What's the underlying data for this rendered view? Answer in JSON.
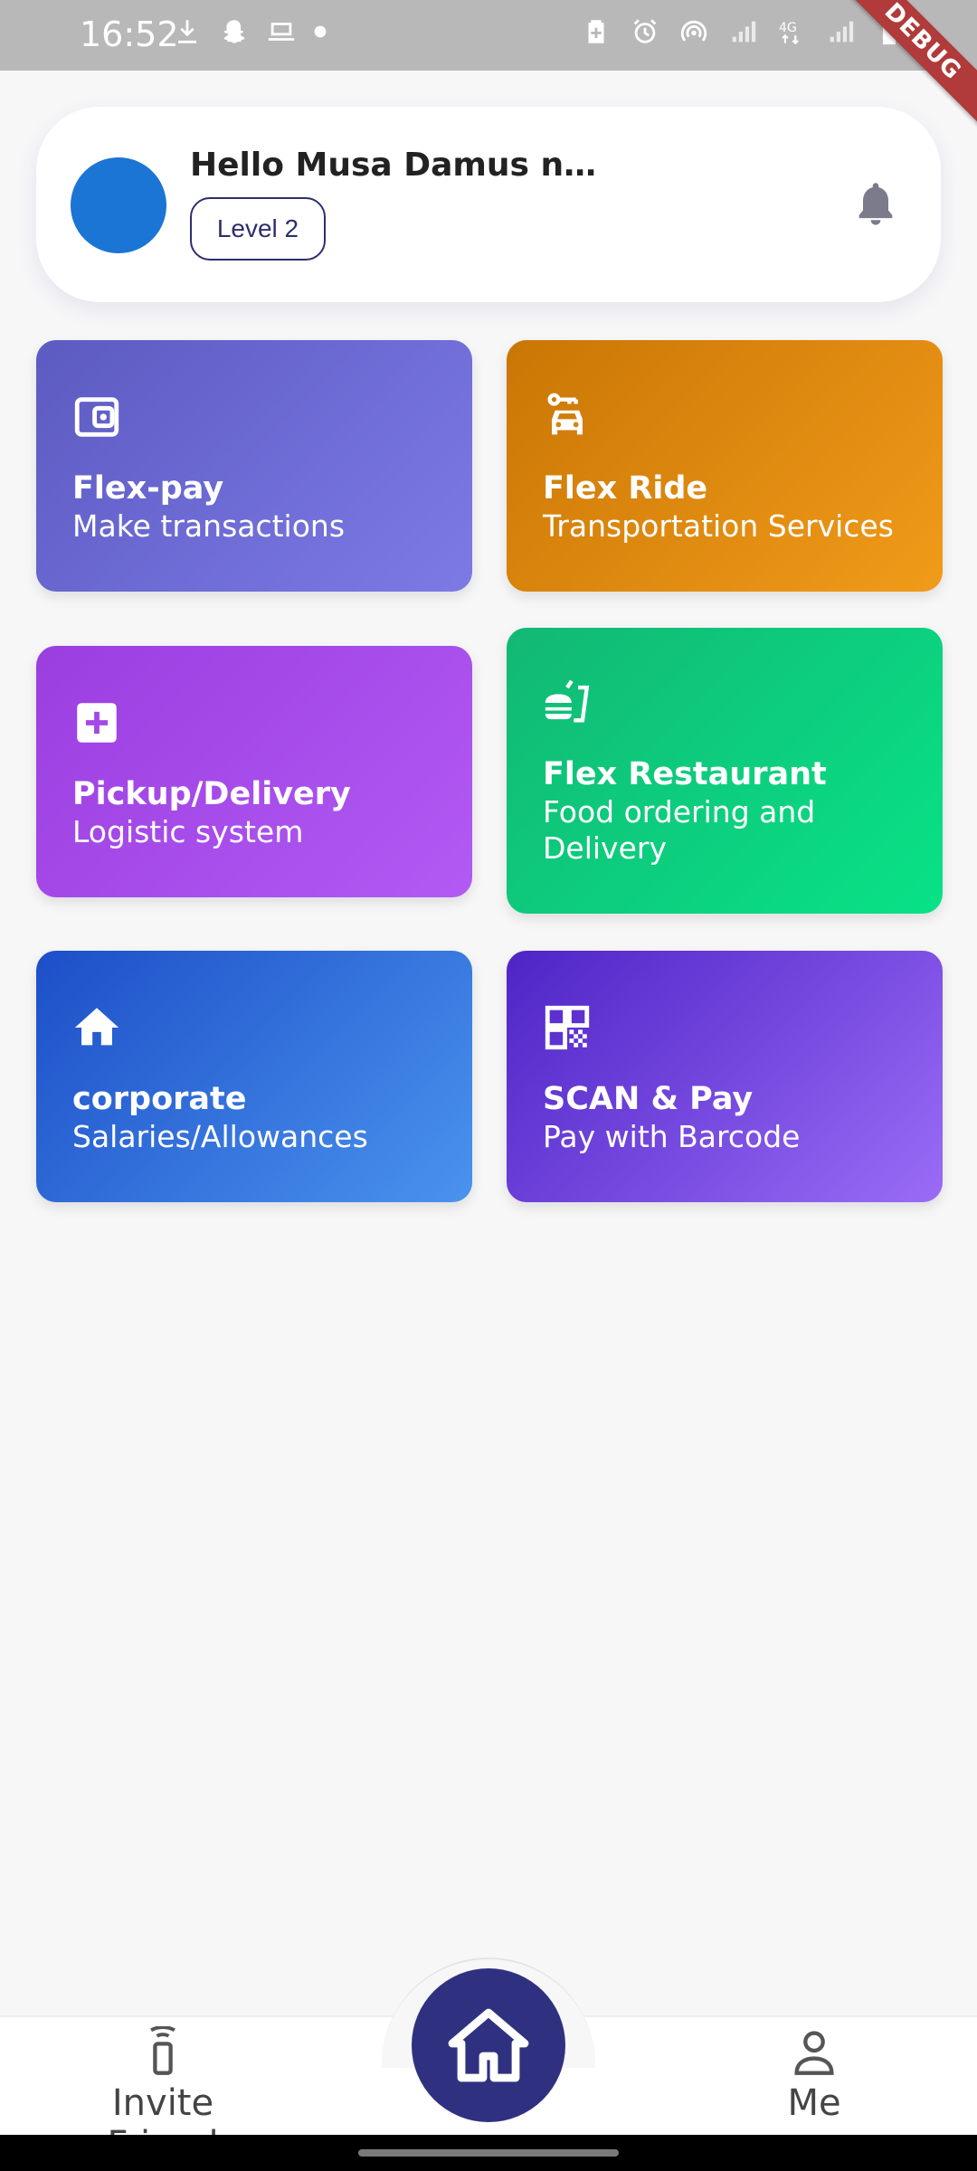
{
  "status_bar": {
    "time": "16:52",
    "left_icons": [
      "download-icon",
      "snapchat-icon",
      "laptop-icon",
      "dot-icon"
    ],
    "right_icons": [
      "battery-saver-icon",
      "alarm-icon",
      "hotspot-icon",
      "signal-icon",
      "4g-icon",
      "signal-icon",
      "battery-icon"
    ],
    "debug_label": "DEBUG"
  },
  "header": {
    "greeting": "Hello Musa Damus n…",
    "level": "Level 2",
    "avatar_color": "#1b75d4"
  },
  "tiles": [
    {
      "title": "Flex-pay",
      "subtitle": "Make transactions",
      "icon": "wallet-icon"
    },
    {
      "title": "Flex Ride",
      "subtitle": "Transportation Services",
      "icon": "car-icon"
    },
    {
      "title": "Pickup/Delivery",
      "subtitle": "Logistic system",
      "icon": "plus-box-icon"
    },
    {
      "title": "Flex Restaurant",
      "subtitle": "Food ordering and Delivery",
      "icon": "fastfood-icon"
    },
    {
      "title": "corporate",
      "subtitle": "Salaries/Allowances",
      "icon": "home-icon"
    },
    {
      "title": "SCAN & Pay",
      "subtitle": "Pay with Barcode",
      "icon": "qr-code-icon"
    }
  ],
  "bottom_nav": {
    "invite_label": "Invite Friend",
    "me_label": "Me",
    "home_icon": "home-icon"
  },
  "colors": {
    "primary": "#2f3180",
    "background": "#f7f7f8"
  }
}
